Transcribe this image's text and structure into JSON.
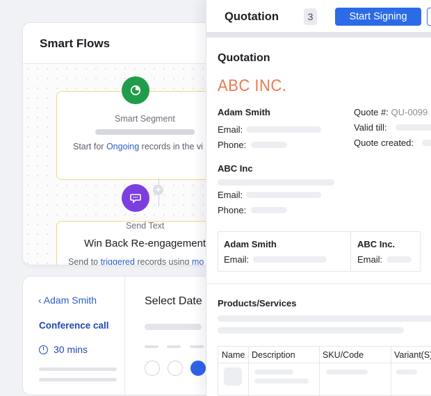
{
  "smart_flows": {
    "title": "Smart Flows",
    "segment_node": {
      "icon": "segment-pie-icon",
      "label": "Smart Segment",
      "desc_prefix": "Start for ",
      "desc_link": "Ongoing",
      "desc_suffix": " records in the vi"
    },
    "text_node": {
      "icon": "chat-bubble-icon",
      "label": "Send Text",
      "title": "Win Back Re-engagement",
      "desc_prefix": "Send to ",
      "desc_link": "triggered",
      "desc_suffix": " records using ",
      "desc_link2": "mo"
    },
    "add_icon": "plus-icon"
  },
  "scheduler": {
    "back_label": "Adam Smith",
    "meeting_type": "Conference call",
    "duration": "30 mins",
    "select_date_label": "Select Date"
  },
  "quotation": {
    "header_title": "Quotation",
    "count_badge": "3",
    "primary_button": "Start Signing",
    "doc_title": "Quotation",
    "company_logo_text": "ABC INC.",
    "contact_name": "Adam Smith",
    "email_label": "Email:",
    "phone_label": "Phone:",
    "quote_number_label": "Quote #:",
    "quote_number_value": "QU-0099",
    "valid_till_label": "Valid till:",
    "quote_created_label": "Quote created:",
    "company_name": "ABC Inc",
    "signer_left_name": "Adam Smith",
    "signer_right_name": "ABC Inc.",
    "products_heading": "Products/Services",
    "table_headers": [
      "Name",
      "Description",
      "SKU/Code",
      "Variant(S)"
    ]
  },
  "colors": {
    "primary_blue": "#2c6be8",
    "link_blue": "#2c5cc5",
    "segment_green": "#1f9d4a",
    "text_purple": "#7b3fe0",
    "logo_orange": "#ea7a4f",
    "node_border": "#f2d77f"
  }
}
